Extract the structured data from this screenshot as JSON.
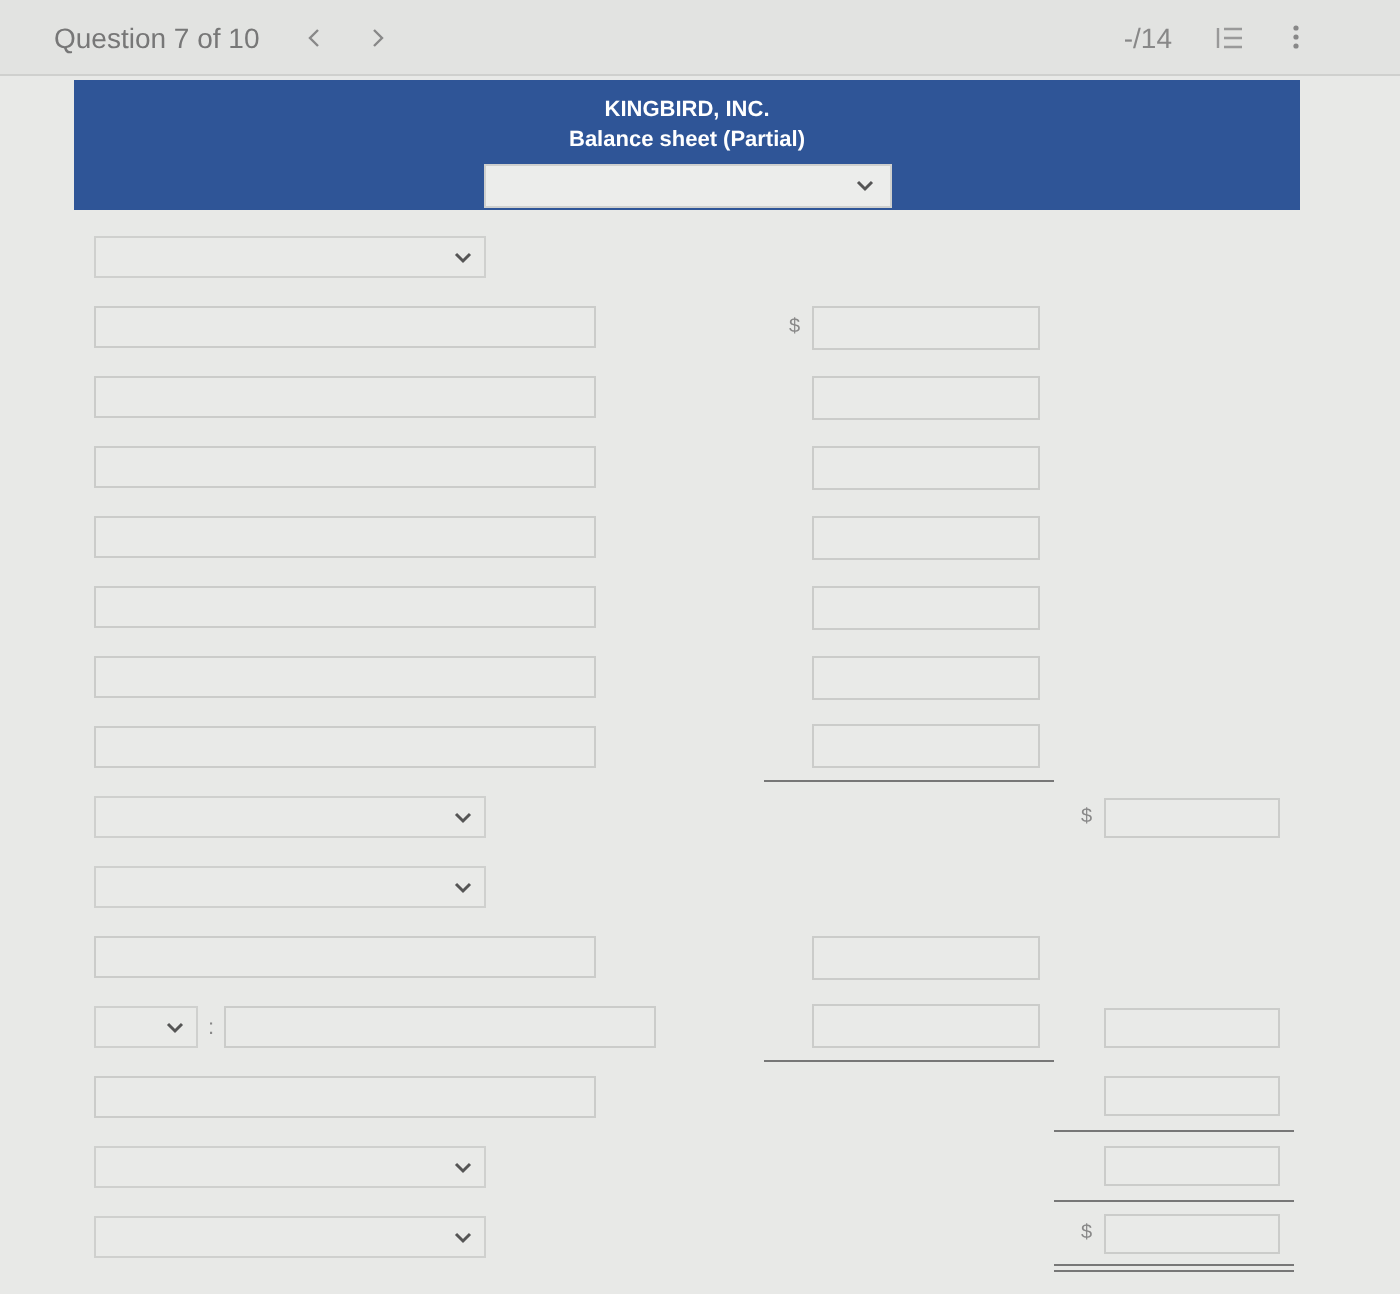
{
  "top_bar": {
    "question_label": "Question 7 of 10",
    "score": "-/14"
  },
  "statement": {
    "company": "KINGBIRD, INC.",
    "title": "Balance sheet (Partial)",
    "heading_field": {
      "kind": "select"
    }
  },
  "rows": [
    {
      "label": {
        "kind": "select"
      }
    },
    {
      "label": {
        "kind": "text"
      },
      "amount_1": {
        "currency": "$",
        "underlined": false,
        "double_underlined": false
      }
    },
    {
      "label": {
        "kind": "text"
      },
      "amount_1": {
        "underlined": false,
        "double_underlined": false
      }
    },
    {
      "label": {
        "kind": "text"
      },
      "amount_1": {
        "underlined": false,
        "double_underlined": false
      }
    },
    {
      "label": {
        "kind": "text"
      },
      "amount_1": {
        "underlined": false,
        "double_underlined": false
      }
    },
    {
      "label": {
        "kind": "text"
      },
      "amount_1": {
        "underlined": false,
        "double_underlined": false
      }
    },
    {
      "label": {
        "kind": "text"
      },
      "amount_1": {
        "underlined": false,
        "double_underlined": false
      }
    },
    {
      "label": {
        "kind": "text"
      },
      "amount_1": {
        "underlined": true,
        "double_underlined": false
      }
    },
    {
      "label": {
        "kind": "select"
      },
      "amount_2": {
        "currency": "$",
        "underlined": false,
        "double_underlined": false
      }
    },
    {
      "label": {
        "kind": "select"
      }
    },
    {
      "label": {
        "kind": "text"
      },
      "amount_1": {
        "underlined": false,
        "double_underlined": false
      }
    },
    {
      "label": {
        "kind": "select-text",
        "separator": ":"
      },
      "amount_1": {
        "underlined": true,
        "double_underlined": false
      },
      "amount_2": {
        "underlined": false,
        "double_underlined": false
      }
    },
    {
      "label": {
        "kind": "text"
      },
      "amount_2": {
        "underlined": true,
        "double_underlined": false
      }
    },
    {
      "label": {
        "kind": "select"
      },
      "amount_2": {
        "underlined": true,
        "double_underlined": false
      }
    },
    {
      "label": {
        "kind": "select"
      },
      "amount_2": {
        "currency": "$",
        "underlined": true,
        "double_underlined": true
      }
    }
  ]
}
